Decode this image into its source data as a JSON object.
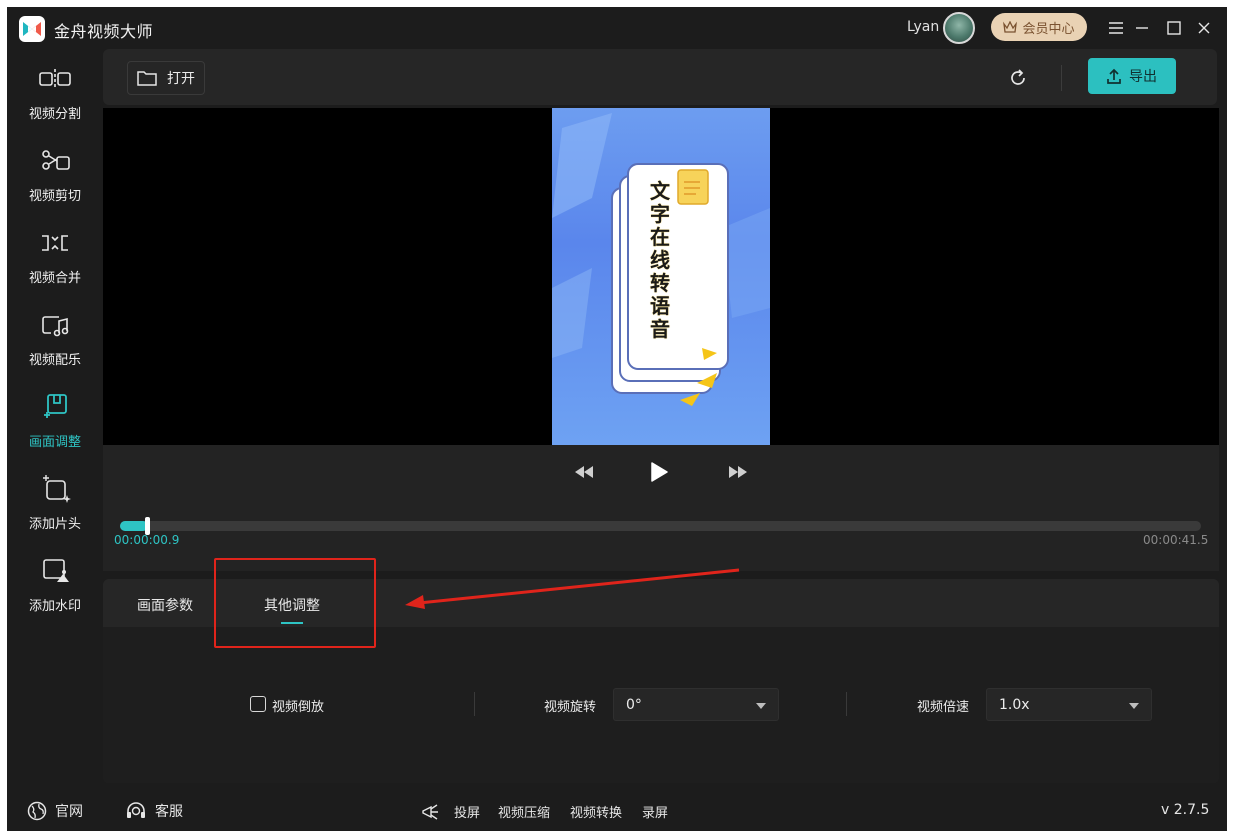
{
  "app": {
    "title": "金舟视频大师",
    "accent": "#2ec4c4"
  },
  "header": {
    "username": "Lyan",
    "vip_label": "会员中心"
  },
  "sidebar": {
    "items": [
      {
        "label": "视频分割",
        "icon": "split-icon"
      },
      {
        "label": "视频剪切",
        "icon": "scissors-icon"
      },
      {
        "label": "视频合并",
        "icon": "merge-icon"
      },
      {
        "label": "视频配乐",
        "icon": "music-icon"
      },
      {
        "label": "画面调整",
        "icon": "frame-adjust-icon",
        "active": true
      },
      {
        "label": "添加片头",
        "icon": "add-intro-icon"
      },
      {
        "label": "添加水印",
        "icon": "watermark-icon"
      }
    ]
  },
  "toolbar": {
    "open_label": "打开",
    "export_label": "导出"
  },
  "video": {
    "caption": "文字在线转语音"
  },
  "player": {
    "current_time": "00:00:00.9",
    "total_time": "00:00:41.5",
    "progress": 0.022
  },
  "panel": {
    "tabs": [
      {
        "label": "画面参数"
      },
      {
        "label": "其他调整",
        "active": true
      }
    ],
    "reverse_label": "视频倒放",
    "reverse_checked": false,
    "rotate_label": "视频旋转",
    "rotate_value": "0°",
    "speed_label": "视频倍速",
    "speed_value": "1.0x"
  },
  "statusbar": {
    "website_label": "官网",
    "support_label": "客服",
    "links": [
      "投屏",
      "视频压缩",
      "视频转换",
      "录屏"
    ],
    "version": "v 2.7.5"
  }
}
